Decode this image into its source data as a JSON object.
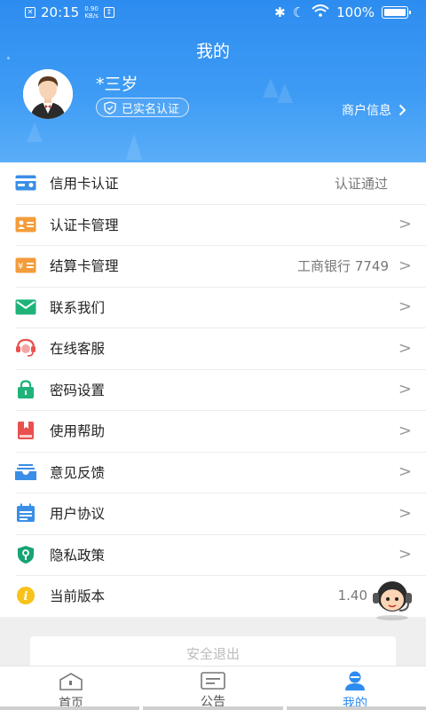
{
  "status_bar": {
    "time": "20:15",
    "net_speed": "0.90",
    "net_unit": "KB/s",
    "battery": "100%"
  },
  "header": {
    "title": "我的",
    "nickname": "*三岁",
    "verified_label": "已实名认证",
    "merchant_label": "商户信息"
  },
  "menu": [
    {
      "name": "credit-card-auth",
      "label": "信用卡认证",
      "value": "认证通过",
      "icon": "credit-card-icon",
      "arrow": false
    },
    {
      "name": "auth-card-manage",
      "label": "认证卡管理",
      "value": "",
      "icon": "id-card-icon",
      "arrow": true
    },
    {
      "name": "settle-card-manage",
      "label": "结算卡管理",
      "value": "工商银行 7749",
      "icon": "yen-card-icon",
      "arrow": true
    },
    {
      "name": "contact-us",
      "label": "联系我们",
      "value": "",
      "icon": "mail-icon",
      "arrow": true
    },
    {
      "name": "online-service",
      "label": "在线客服",
      "value": "",
      "icon": "headset-icon",
      "arrow": true
    },
    {
      "name": "password-settings",
      "label": "密码设置",
      "value": "",
      "icon": "lock-icon",
      "arrow": true
    },
    {
      "name": "help",
      "label": "使用帮助",
      "value": "",
      "icon": "book-icon",
      "arrow": true
    },
    {
      "name": "feedback",
      "label": "意见反馈",
      "value": "",
      "icon": "inbox-icon",
      "arrow": true
    },
    {
      "name": "user-agreement",
      "label": "用户协议",
      "value": "",
      "icon": "calendar-list-icon",
      "arrow": true
    },
    {
      "name": "privacy-policy",
      "label": "隐私政策",
      "value": "",
      "icon": "shield-key-icon",
      "arrow": true
    },
    {
      "name": "current-version",
      "label": "当前版本",
      "value": "1.40",
      "icon": "info-icon",
      "arrow": false
    }
  ],
  "logout_label": "安全退出",
  "tabs": [
    {
      "name": "home",
      "label": "首页",
      "icon": "home-icon",
      "active": false
    },
    {
      "name": "notice",
      "label": "公告",
      "icon": "notice-icon",
      "active": false
    },
    {
      "name": "mine",
      "label": "我的",
      "icon": "user-icon",
      "active": true
    }
  ],
  "colors": {
    "primary": "#2d8cf0",
    "orange": "#f39c3a",
    "green": "#1fb37a",
    "red": "#e9514f",
    "yellow": "#f7c21a"
  }
}
